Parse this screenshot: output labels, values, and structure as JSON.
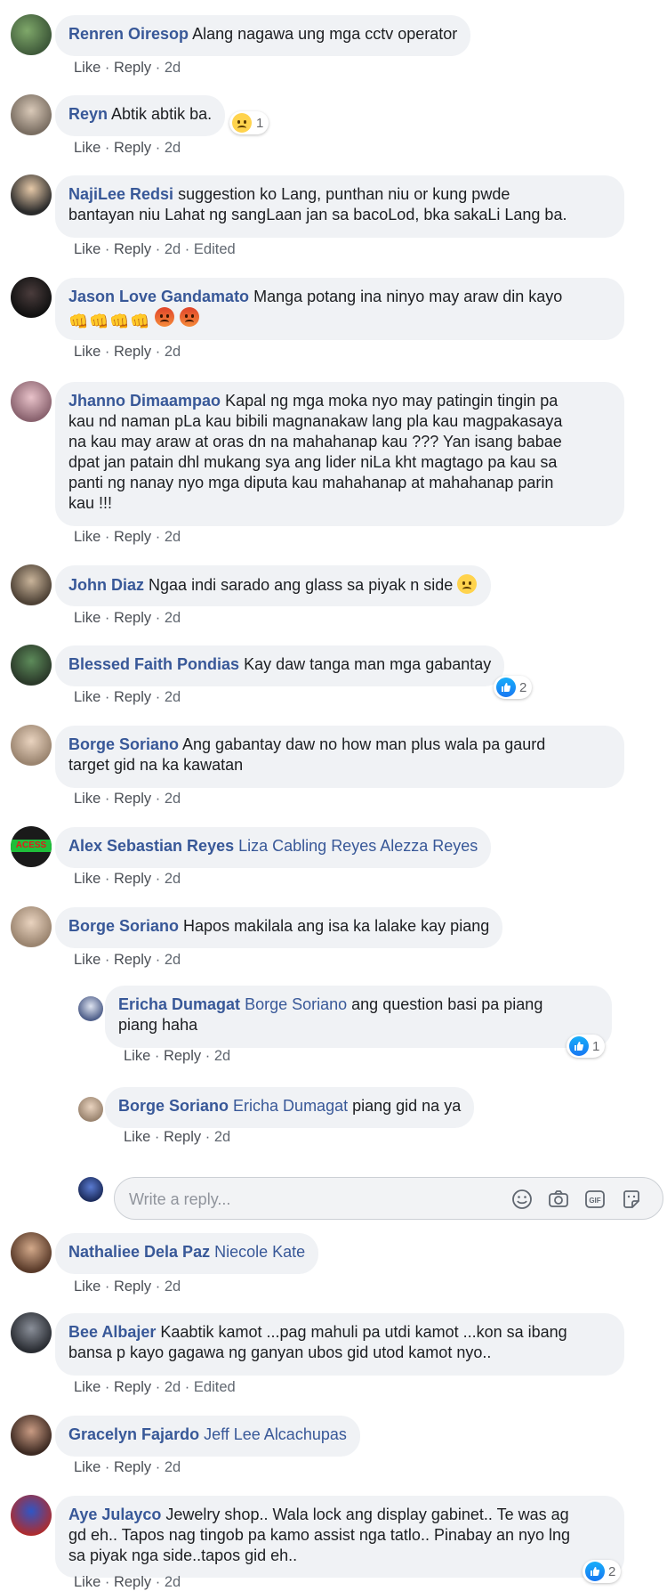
{
  "actions": {
    "like": "Like",
    "reply": "Reply",
    "sep": "·",
    "time": "2d",
    "edited": "Edited"
  },
  "comments": [
    {
      "author": "Renren Oiresop",
      "text": "Alang nagawa ung mga cctv operator"
    },
    {
      "author": "Reyn",
      "text": "Abtik abtik ba.",
      "reaction_count": "1"
    },
    {
      "author": "NajiLee Redsi",
      "text_line1": "suggestion ko Lang, punthan niu or kung pwde",
      "text_line2": "bantayan niu Lahat ng sangLaan jan sa bacoLod, bka sakaLi Lang ba."
    },
    {
      "author": "Jason Love Gandamato",
      "text": "Manga potang ina ninyo may araw din kayo"
    },
    {
      "author": "Jhanno Dimaampao",
      "text_line1": "Kapal ng mga moka nyo may patingin tingin pa",
      "text_line2": "kau nd naman pLa kau bibili magnanakaw lang pla kau magpakasaya",
      "text_line3": "na kau may araw at oras dn na mahahanap kau ??? Yan isang babae",
      "text_line4": "dpat jan patain dhl mukang sya ang lider niLa kht magtago pa kau sa",
      "text_line5": "panti ng nanay nyo mga diputa kau mahahanap at mahahanap parin",
      "text_line6": "kau !!!"
    },
    {
      "author": "John Diaz",
      "text": "Ngaa indi sarado ang glass sa piyak n side"
    },
    {
      "author": "Blessed Faith Pondias",
      "text": "Kay daw tanga man mga gabantay",
      "reaction_count": "2"
    },
    {
      "author": "Borge Soriano",
      "text_line1": "Ang gabantay daw no how man plus wala pa gaurd",
      "text_line2": "target gid na ka kawatan"
    },
    {
      "author": "Alex Sebastian Reyes",
      "mention": "Liza Cabling Reyes Alezza Reyes",
      "avatar_text": "ACESS"
    },
    {
      "author": "Borge Soriano",
      "text": "Hapos makilala ang isa ka lalake kay piang"
    },
    {
      "author": "Ericha Dumagat",
      "mention": "Borge Soriano",
      "text_line1": "ang question basi pa piang",
      "text_line2": "piang haha",
      "reaction_count": "1"
    },
    {
      "author": "Borge Soriano",
      "mention": "Ericha Dumagat",
      "text": "piang gid na ya"
    },
    {
      "author": "Nathaliee Dela Paz",
      "mention": "Niecole Kate"
    },
    {
      "author": "Bee Albajer",
      "text_line1": "Kaabtik kamot ...pag mahuli pa utdi kamot ...kon sa ibang",
      "text_line2": "bansa p kayo gagawa ng ganyan ubos gid utod kamot nyo.."
    },
    {
      "author": "Gracelyn Fajardo",
      "mention": "Jeff Lee Alcachupas"
    },
    {
      "author": "Aye Julayco",
      "text_line1": "Jewelry shop.. Wala lock ang display gabinet.. Te was ag",
      "text_line2": "gd eh.. Tapos nag tingob pa kamo assist nga tatlo.. Pinabay an nyo lng",
      "text_line3": "sa piyak nga side..tapos gid eh..",
      "reaction_count": "2"
    }
  ],
  "reply_box": {
    "placeholder": "Write a reply..."
  },
  "colors": {
    "author": "#385898",
    "bubble": "#f0f2f5",
    "meta": "#606770",
    "like_blue": "#1877f2"
  },
  "icons": [
    "emoji-icon",
    "camera-icon",
    "gif-icon",
    "sticker-icon",
    "like-reaction-icon",
    "sad-reaction-icon"
  ]
}
